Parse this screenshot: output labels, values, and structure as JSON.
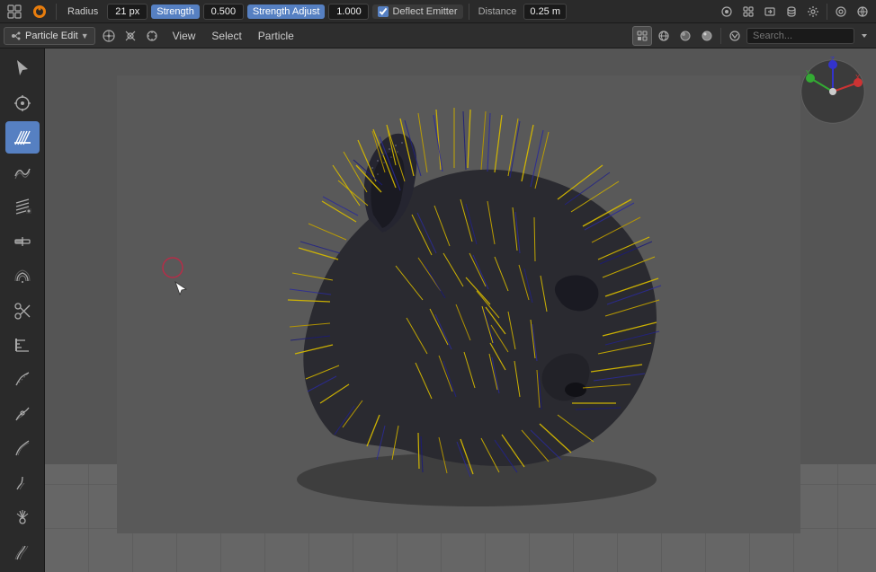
{
  "topbar": {
    "radius_label": "Radius",
    "radius_value": "21 px",
    "strength_label": "Strength",
    "strength_value": "0.500",
    "strength_adjust_label": "Strength Adjust",
    "strength_adjust_value": "1.000",
    "deflect_emitter_label": "Deflect Emitter",
    "deflect_emitter_checked": true,
    "distance_label": "Distance",
    "distance_value": "0.25 m"
  },
  "secondbar": {
    "mode_label": "Particle Edit",
    "menu_items": [
      "View",
      "Select",
      "Particle"
    ]
  },
  "tools": [
    {
      "name": "select-tool",
      "icon": "⊹",
      "active": false,
      "label": "Select"
    },
    {
      "name": "cursor-tool",
      "icon": "◎",
      "active": false,
      "label": "Cursor"
    },
    {
      "name": "comb-tool",
      "icon": "≋",
      "active": true,
      "label": "Comb"
    },
    {
      "name": "smooth-tool",
      "icon": "∿",
      "active": false,
      "label": "Smooth"
    },
    {
      "name": "add-tool",
      "icon": "⊞",
      "active": false,
      "label": "Add"
    },
    {
      "name": "length-tool",
      "icon": "⁕",
      "active": false,
      "label": "Length"
    },
    {
      "name": "puff-tool",
      "icon": "≈",
      "active": false,
      "label": "Puff"
    },
    {
      "name": "cut-tool",
      "icon": "✂",
      "active": false,
      "label": "Cut"
    },
    {
      "name": "weight-tool",
      "icon": "⊟",
      "active": false,
      "label": "Weight"
    },
    {
      "name": "straighten-tool",
      "icon": "≀",
      "active": false,
      "label": "Straighten"
    },
    {
      "name": "deflect-tool",
      "icon": "⊿",
      "active": false,
      "label": "Deflect"
    },
    {
      "name": "merge-tool",
      "icon": "⊸",
      "active": false,
      "label": "Merge"
    }
  ],
  "viewport": {
    "background_color": "#595959"
  },
  "colors": {
    "active_blue": "#5680c2",
    "bg_dark": "#2a2a2a",
    "bg_medium": "#3a3a3a",
    "hair_yellow": "#d4b800",
    "hair_blue": "#3333aa",
    "model_dark": "#333344"
  }
}
